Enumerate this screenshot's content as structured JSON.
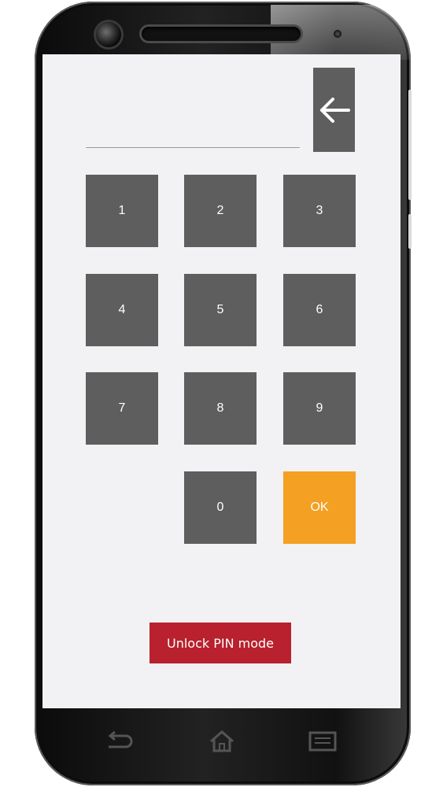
{
  "pin": {
    "value": "",
    "backspace_icon": "arrow-left-icon"
  },
  "keypad": {
    "keys": [
      "1",
      "2",
      "3",
      "4",
      "5",
      "6",
      "7",
      "8",
      "9",
      "0"
    ],
    "ok_label": "OK",
    "ok_color": "#f4a023",
    "key_color": "#5e5e5e"
  },
  "unlock": {
    "label": "Unlock PIN mode",
    "color": "#b8212d"
  },
  "navbar": {
    "icons": [
      "back-icon",
      "home-icon",
      "recent-apps-icon"
    ]
  }
}
